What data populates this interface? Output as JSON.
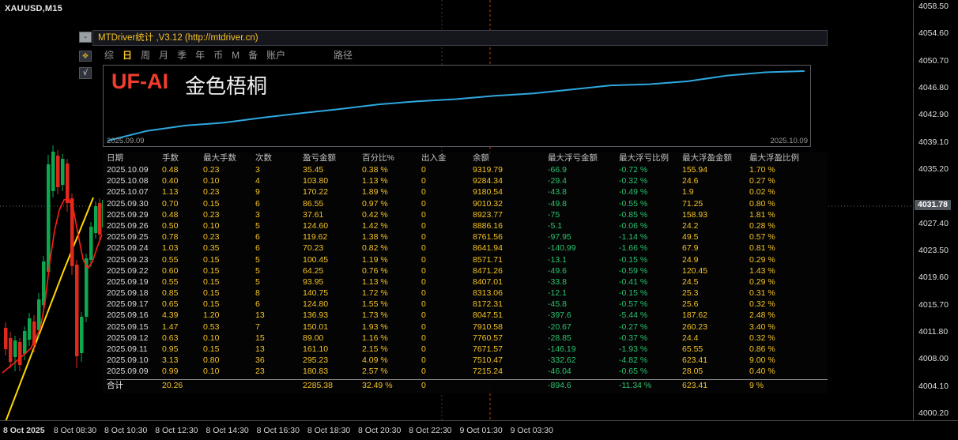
{
  "colors": {
    "accent_yellow": "#f5c426",
    "value_green": "#2bc36f",
    "curve_blue": "#2fa8e0",
    "watermark_red": "#f23d2e",
    "candle_green": "#0da750",
    "candle_red": "#dd2a1c",
    "ma_red": "#ff2016",
    "trend_yellow": "#ffd800",
    "separator_orange": "#b34a10",
    "grid_gray": "#3c3c3c"
  },
  "terminal": {
    "symbol": "XAUUSD,M15",
    "price_axis": {
      "labels": [
        "4058.50",
        "4054.60",
        "4050.70",
        "4046.80",
        "4042.90",
        "4039.10",
        "4035.20",
        "4027.40",
        "4023.50",
        "4019.60",
        "4015.70",
        "4011.80",
        "4008.00",
        "4004.10",
        "4000.20"
      ],
      "current_price": "4031.78"
    },
    "time_axis": [
      "8 Oct 2025",
      "8 Oct 08:30",
      "8 Oct 10:30",
      "8 Oct 12:30",
      "8 Oct 14:30",
      "8 Oct 16:30",
      "8 Oct 18:30",
      "8 Oct 20:30",
      "8 Oct 22:30",
      "9 Oct 01:30",
      "9 Oct 03:30"
    ]
  },
  "panel": {
    "title": "MTDriver统计 ,V3.12 (http://mtdriver.cn)",
    "buttons": {
      "minimize": "-",
      "move_icon": "❖",
      "check": "√"
    },
    "tabs": [
      "综",
      "日",
      "周",
      "月",
      "季",
      "年",
      "币",
      "M",
      "备",
      "账户"
    ],
    "active_tab": "日",
    "path_button": "路径",
    "equity_chart": {
      "watermark_brand": "UF-AI",
      "watermark_name": "金色梧桐",
      "start_date": "2025.09.09",
      "end_date": "2025.10.09"
    },
    "table": {
      "headers": [
        "日期",
        "手数",
        "最大手数",
        "次数",
        "盈亏金额",
        "百分比%",
        "出入金",
        "余额",
        "最大浮亏金额",
        "最大浮亏比例",
        "最大浮盈金额",
        "最大浮盈比例"
      ],
      "rows": [
        [
          "2025.10.09",
          "0.48",
          "0.23",
          "3",
          "35.45",
          "0.38 %",
          "0",
          "9319.79",
          "-66.9",
          "-0.72 %",
          "155.94",
          "1.70 %"
        ],
        [
          "2025.10.08",
          "0.40",
          "0.10",
          "4",
          "103.80",
          "1.13 %",
          "0",
          "9284.34",
          "-29.4",
          "-0.32 %",
          "24.6",
          "0.27 %"
        ],
        [
          "2025.10.07",
          "1.13",
          "0.23",
          "9",
          "170.22",
          "1.89 %",
          "0",
          "9180.54",
          "-43.8",
          "-0.49 %",
          "1.9",
          "0.02 %"
        ],
        [
          "2025.09.30",
          "0.70",
          "0.15",
          "6",
          "86.55",
          "0.97 %",
          "0",
          "9010.32",
          "-49.8",
          "-0.55 %",
          "71.25",
          "0.80 %"
        ],
        [
          "2025.09.29",
          "0.48",
          "0.23",
          "3",
          "37.61",
          "0.42 %",
          "0",
          "8923.77",
          "-75",
          "-0.85 %",
          "158.93",
          "1.81 %"
        ],
        [
          "2025.09.26",
          "0.50",
          "0.10",
          "5",
          "124.60",
          "1.42 %",
          "0",
          "8886.16",
          "-5.1",
          "-0.06 %",
          "24.2",
          "0.28 %"
        ],
        [
          "2025.09.25",
          "0.78",
          "0.23",
          "6",
          "119.62",
          "1.38 %",
          "0",
          "8761.56",
          "-97.95",
          "-1.14 %",
          "49.5",
          "0.57 %"
        ],
        [
          "2025.09.24",
          "1.03",
          "0.35",
          "6",
          "70.23",
          "0.82 %",
          "0",
          "8641.94",
          "-140.99",
          "-1.66 %",
          "67.9",
          "0.81 %"
        ],
        [
          "2025.09.23",
          "0.55",
          "0.15",
          "5",
          "100.45",
          "1.19 %",
          "0",
          "8571.71",
          "-13.1",
          "-0.15 %",
          "24.9",
          "0.29 %"
        ],
        [
          "2025.09.22",
          "0.60",
          "0.15",
          "5",
          "64.25",
          "0.76 %",
          "0",
          "8471.26",
          "-49.6",
          "-0.59 %",
          "120.45",
          "1.43 %"
        ],
        [
          "2025.09.19",
          "0.55",
          "0.15",
          "5",
          "93.95",
          "1.13 %",
          "0",
          "8407.01",
          "-33.8",
          "-0.41 %",
          "24.5",
          "0.29 %"
        ],
        [
          "2025.09.18",
          "0.85",
          "0.15",
          "8",
          "140.75",
          "1.72 %",
          "0",
          "8313.06",
          "-12.1",
          "-0.15 %",
          "25.3",
          "0.31 %"
        ],
        [
          "2025.09.17",
          "0.65",
          "0.15",
          "6",
          "124.80",
          "1.55 %",
          "0",
          "8172.31",
          "-45.8",
          "-0.57 %",
          "25.6",
          "0.32 %"
        ],
        [
          "2025.09.16",
          "4.39",
          "1.20",
          "13",
          "136.93",
          "1.73 %",
          "0",
          "8047.51",
          "-397.6",
          "-5.44 %",
          "187.62",
          "2.48 %"
        ],
        [
          "2025.09.15",
          "1.47",
          "0.53",
          "7",
          "150.01",
          "1.93 %",
          "0",
          "7910.58",
          "-20.67",
          "-0.27 %",
          "260.23",
          "3.40 %"
        ],
        [
          "2025.09.12",
          "0.63",
          "0.10",
          "15",
          "89.00",
          "1.16 %",
          "0",
          "7760.57",
          "-28.85",
          "-0.37 %",
          "24.4",
          "0.32 %"
        ],
        [
          "2025.09.11",
          "0.95",
          "0.15",
          "13",
          "161.10",
          "2.15 %",
          "0",
          "7671.57",
          "-146.19",
          "-1.93 %",
          "65.55",
          "0.86 %"
        ],
        [
          "2025.09.10",
          "3.13",
          "0.80",
          "36",
          "295.23",
          "4.09 %",
          "0",
          "7510.47",
          "-332.62",
          "-4.82 %",
          "623.41",
          "9.00 %"
        ],
        [
          "2025.09.09",
          "0.99",
          "0.10",
          "23",
          "180.83",
          "2.57 %",
          "0",
          "7215.24",
          "-46.04",
          "-0.65 %",
          "28.05",
          "0.40 %"
        ]
      ],
      "total_row": [
        "合计",
        "20.26",
        "",
        "",
        "2285.38",
        "32.49 %",
        "0",
        "",
        "-894.6",
        "-11.34 %",
        "623.41",
        "9 %"
      ]
    }
  },
  "chart_data": {
    "type": "line",
    "title": "MTDriver equity curve (UF-AI 金色梧桐)",
    "x": [
      "2025.09.09",
      "2025.09.10",
      "2025.09.11",
      "2025.09.12",
      "2025.09.15",
      "2025.09.16",
      "2025.09.17",
      "2025.09.18",
      "2025.09.19",
      "2025.09.22",
      "2025.09.23",
      "2025.09.24",
      "2025.09.25",
      "2025.09.26",
      "2025.09.29",
      "2025.09.30",
      "2025.10.07",
      "2025.10.08",
      "2025.10.09"
    ],
    "series": [
      {
        "name": "余额",
        "values": [
          7215.24,
          7510.47,
          7671.57,
          7760.57,
          7910.58,
          8047.51,
          8172.31,
          8313.06,
          8407.01,
          8471.26,
          8571.71,
          8641.94,
          8761.56,
          8886.16,
          8923.77,
          9010.32,
          9180.54,
          9284.34,
          9319.79
        ]
      }
    ],
    "xlabel": "",
    "ylabel": "",
    "legend_position": "none",
    "grid": false
  }
}
